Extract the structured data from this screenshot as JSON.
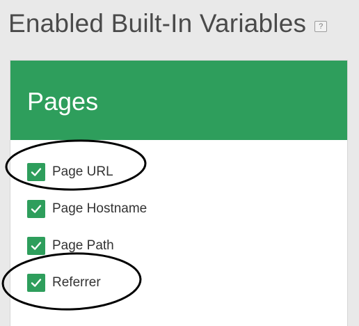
{
  "page": {
    "title": "Enabled Built-In Variables",
    "help_label": "?"
  },
  "card": {
    "title": "Pages",
    "header_color": "#2e9e5c",
    "items": [
      {
        "label": "Page URL",
        "checked": true
      },
      {
        "label": "Page Hostname",
        "checked": true
      },
      {
        "label": "Page Path",
        "checked": true
      },
      {
        "label": "Referrer",
        "checked": true
      }
    ]
  },
  "icons": {
    "help": "help-icon",
    "check": "check-icon"
  }
}
